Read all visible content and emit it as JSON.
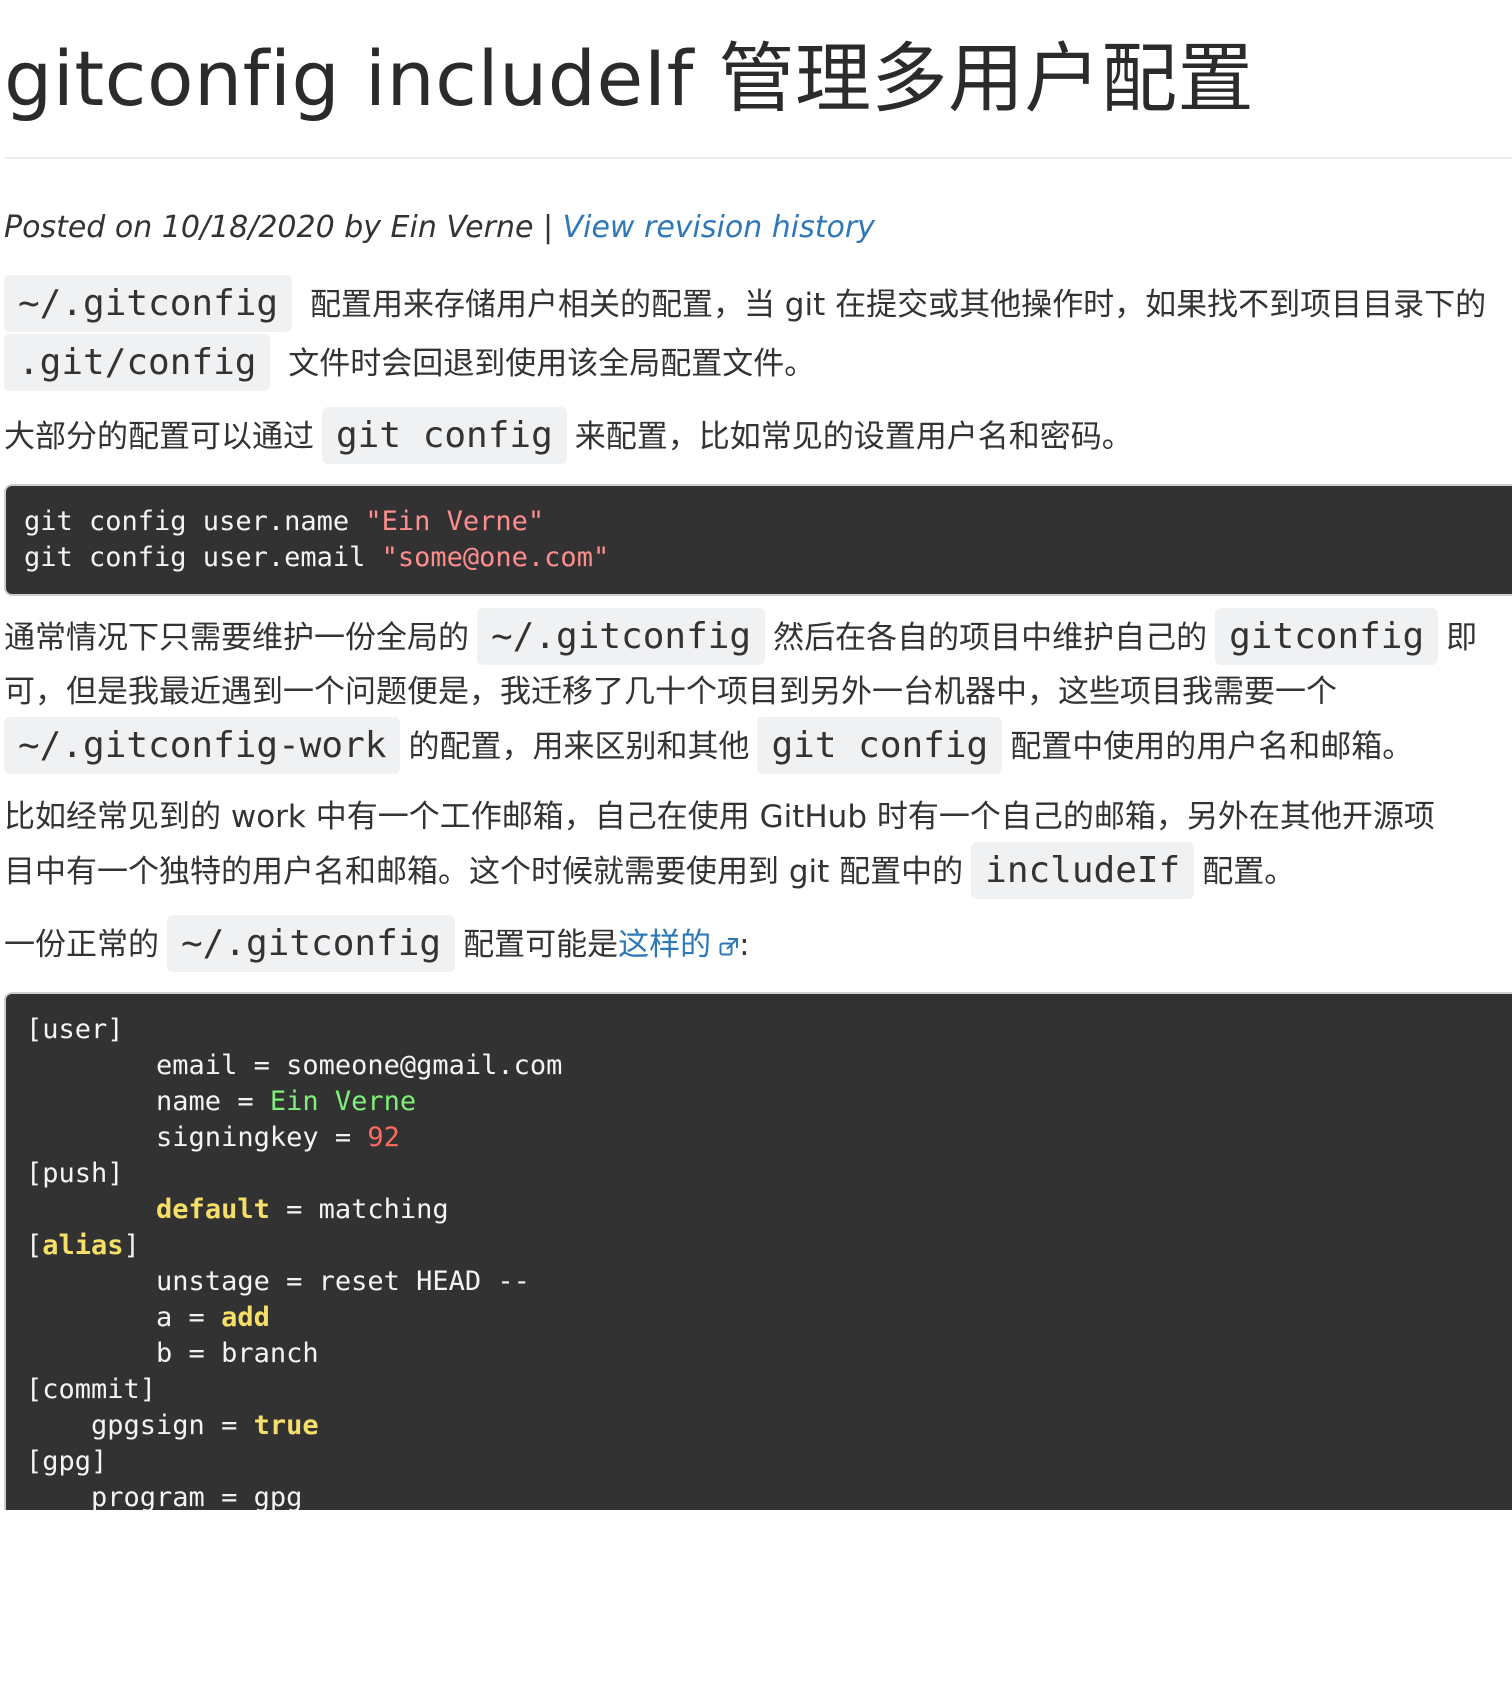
{
  "title": "gitconfig includeIf 管理多用户配置",
  "meta": {
    "posted_prefix": "Posted on 10/18/2020 by Ein Verne | ",
    "revision_link": "View revision history"
  },
  "p1": {
    "code1": "~/.gitconfig",
    "text1": " 配置用来存储用户相关的配置，当 git 在提交或其他操作时，如果找不到项目目录下的",
    "code2": ".git/config",
    "text2": " 文件时会回退到使用该全局配置文件。"
  },
  "p2": {
    "text1": "大部分的配置可以通过",
    "code1": "git config",
    "text2": "来配置，比如常见的设置用户名和密码。"
  },
  "code_block_1": {
    "line1_cmd": "git config user.name ",
    "line1_str": "\"Ein Verne\"",
    "line2_cmd": "git config user.email ",
    "line2_str": "\"some@one.com\""
  },
  "p3": {
    "text1": "通常情况下只需要维护一份全局的",
    "code1": "~/.gitconfig",
    "text2": "然后在各自的项目中维护自己的",
    "code2": "gitconfig",
    "text3": "即",
    "text4": "可，但是我最近遇到一个问题便是，我迁移了几十个项目到另外一台机器中，这些项目我需要一个",
    "code3": "~/.gitconfig-work",
    "text5": "的配置，用来区别和其他",
    "code4": "git config",
    "text6": "配置中使用的用户名和邮箱。"
  },
  "p4": {
    "text1": "比如经常见到的 work 中有一个工作邮箱，自己在使用 GitHub 时有一个自己的邮箱，另外在其他开源项",
    "text2": "目中有一个独特的用户名和邮箱。这个时候就需要使用到 git 配置中的",
    "code1": "includeIf",
    "text3": "配置。"
  },
  "p5": {
    "text1": "一份正常的",
    "code1": "~/.gitconfig",
    "text2": "配置可能是",
    "link": "这样的",
    "text3": ":"
  },
  "code_block_2": {
    "l1": "[user]",
    "l2_key": "        email = someone@gmail.com",
    "l3_key": "        name = ",
    "l3_val": "Ein Verne",
    "l4_key": "        signingkey = ",
    "l4_val": "92",
    "l5": "[push]",
    "l6_pre": "        ",
    "l6_kw": "default",
    "l6_rest": " = matching",
    "l7_open": "[",
    "l7_kw": "alias",
    "l7_close": "]",
    "l8": "        unstage = reset HEAD --",
    "l9_key": "        a = ",
    "l9_kw": "add",
    "l10": "        b = branch",
    "l11": "[commit]",
    "l12_key": "    gpgsign = ",
    "l12_kw": "true",
    "l13": "[gpg]",
    "l14": "    program = gpg"
  },
  "colors": {
    "link": "#2f78b7",
    "code_bg": "#323232",
    "string": "#ff8d8d",
    "green_value": "#7ef07a",
    "number": "#ff6b5f",
    "keyword": "#f6df69",
    "inline_code_bg": "#f0f1f3"
  }
}
